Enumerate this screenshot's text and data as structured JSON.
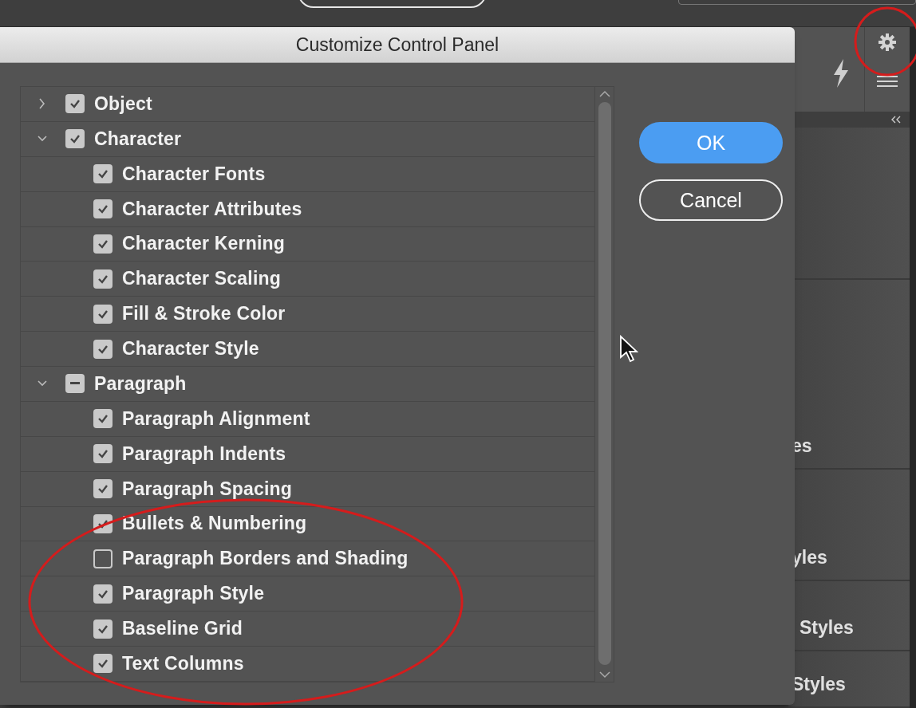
{
  "dialog": {
    "title": "Customize Control Panel",
    "tree": [
      {
        "label": "Object",
        "expanded": false,
        "checked": true,
        "mixed": false
      },
      {
        "label": "Character",
        "expanded": true,
        "checked": true,
        "mixed": false,
        "children": [
          {
            "label": "Character Fonts",
            "checked": true
          },
          {
            "label": "Character Attributes",
            "checked": true
          },
          {
            "label": "Character Kerning",
            "checked": true
          },
          {
            "label": "Character Scaling",
            "checked": true
          },
          {
            "label": "Fill & Stroke Color",
            "checked": true
          },
          {
            "label": "Character Style",
            "checked": true
          }
        ]
      },
      {
        "label": "Paragraph",
        "expanded": true,
        "checked": true,
        "mixed": true,
        "children": [
          {
            "label": "Paragraph Alignment",
            "checked": true
          },
          {
            "label": "Paragraph Indents",
            "checked": true
          },
          {
            "label": "Paragraph Spacing",
            "checked": true
          },
          {
            "label": "Bullets & Numbering",
            "checked": true
          },
          {
            "label": "Paragraph Borders and Shading",
            "checked": false
          },
          {
            "label": "Paragraph Style",
            "checked": true
          },
          {
            "label": "Baseline Grid",
            "checked": true
          },
          {
            "label": "Text Columns",
            "checked": true
          }
        ]
      }
    ],
    "buttons": [
      {
        "label": "OK",
        "kind": "primary"
      },
      {
        "label": "Cancel",
        "kind": "secondary"
      }
    ]
  },
  "side_panel": {
    "sections": [
      {
        "label": "es"
      },
      {
        "label": "yles"
      },
      {
        "label": "Styles"
      },
      {
        "label": "Styles"
      }
    ]
  }
}
